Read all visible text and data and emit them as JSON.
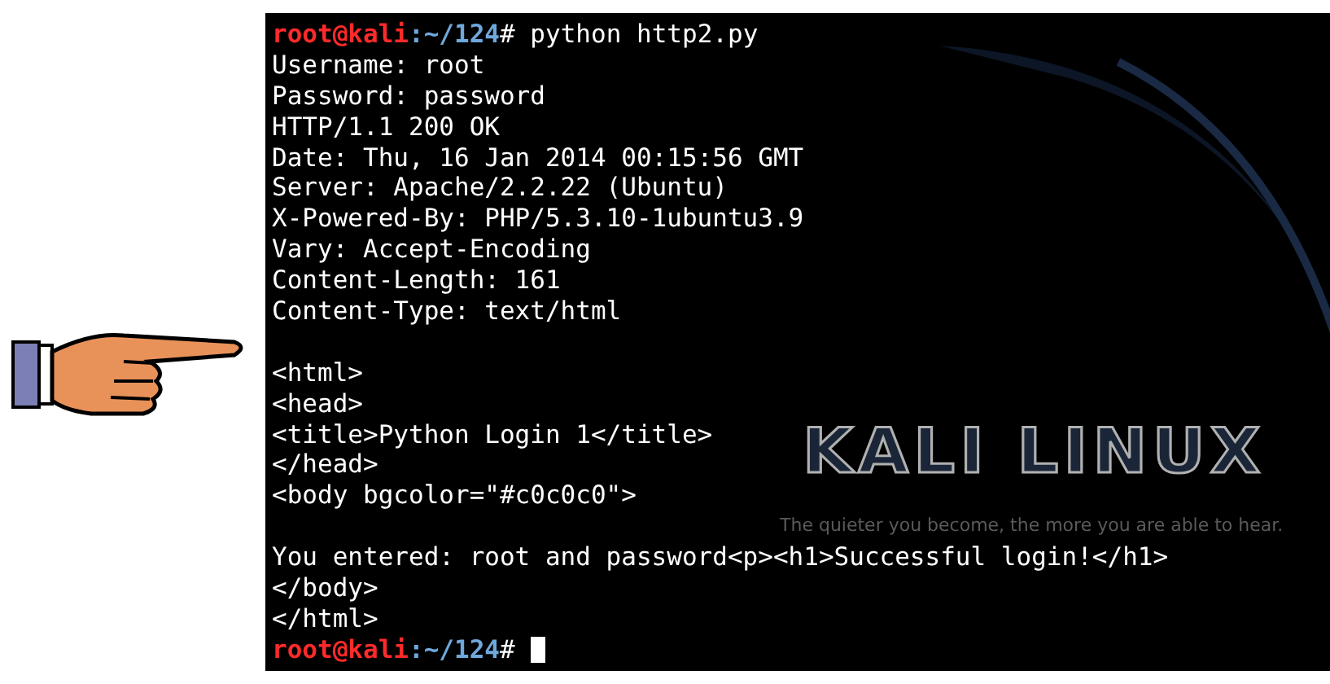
{
  "terminal": {
    "lines": [
      {
        "kind": "prompt",
        "user": "root@kali",
        "path": ":~/124",
        "symbol": "#",
        "command": " python http2.py"
      },
      {
        "kind": "output",
        "text": "Username: root"
      },
      {
        "kind": "output",
        "text": "Password: password"
      },
      {
        "kind": "output",
        "text": "HTTP/1.1 200 OK"
      },
      {
        "kind": "output",
        "text": "Date: Thu, 16 Jan 2014 00:15:56 GMT"
      },
      {
        "kind": "output",
        "text": "Server: Apache/2.2.22 (Ubuntu)"
      },
      {
        "kind": "output",
        "text": "X-Powered-By: PHP/5.3.10-1ubuntu3.9"
      },
      {
        "kind": "output",
        "text": "Vary: Accept-Encoding"
      },
      {
        "kind": "output",
        "text": "Content-Length: 161"
      },
      {
        "kind": "output",
        "text": "Content-Type: text/html"
      },
      {
        "kind": "blank"
      },
      {
        "kind": "output",
        "text": "<html>"
      },
      {
        "kind": "output",
        "text": "<head>"
      },
      {
        "kind": "output",
        "text": "<title>Python Login 1</title>"
      },
      {
        "kind": "output",
        "text": "</head>"
      },
      {
        "kind": "output",
        "text": "<body bgcolor=\"#c0c0c0\">"
      },
      {
        "kind": "blank"
      },
      {
        "kind": "output",
        "text": "You entered: root and password<p><h1>Successful login!</h1>"
      },
      {
        "kind": "output",
        "text": "</body>"
      },
      {
        "kind": "output",
        "text": "</html>"
      },
      {
        "kind": "prompt",
        "user": "root@kali",
        "path": ":~/124",
        "symbol": "#",
        "cursor": true
      }
    ]
  },
  "wallpaper": {
    "logo": "KALI LINUX",
    "tagline": "The quieter you become, the more you are able to hear."
  }
}
